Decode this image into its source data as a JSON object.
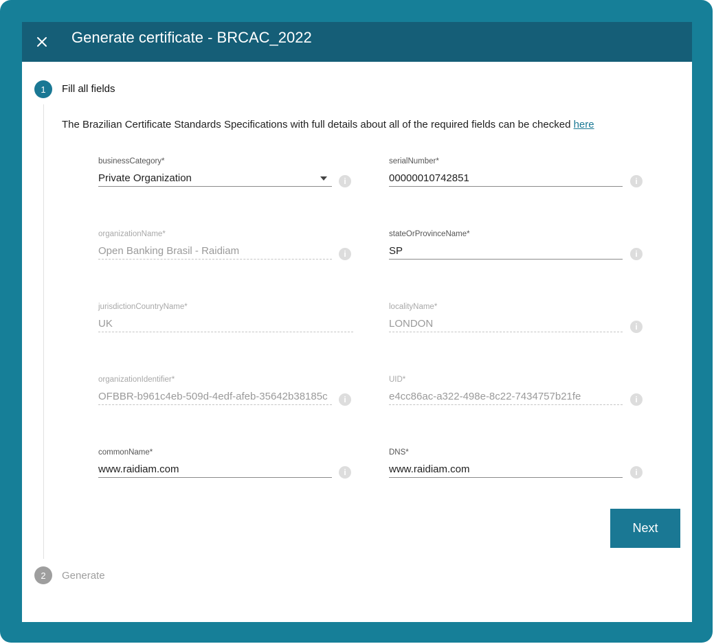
{
  "dialog": {
    "title": "Generate certificate - BRCAC_2022"
  },
  "stepper": {
    "step1": {
      "number": "1",
      "label": "Fill all fields"
    },
    "step2": {
      "number": "2",
      "label": "Generate"
    }
  },
  "description": {
    "text": "The Brazilian Certificate Standards Specifications with full details about all of the required fields can be checked ",
    "link": "here"
  },
  "fields": {
    "businessCategory": {
      "label": "businessCategory*",
      "value": "Private Organization"
    },
    "serialNumber": {
      "label": "serialNumber*",
      "value": "00000010742851"
    },
    "organizationName": {
      "label": "organizationName*",
      "value": "Open Banking Brasil - Raidiam"
    },
    "stateOrProvinceName": {
      "label": "stateOrProvinceName*",
      "value": "SP"
    },
    "jurisdictionCountryName": {
      "label": "jurisdictionCountryName*",
      "value": "UK"
    },
    "localityName": {
      "label": "localityName*",
      "value": "LONDON"
    },
    "organizationIdentifier": {
      "label": "organizationIdentifier*",
      "value": "OFBBR-b961c4eb-509d-4edf-afeb-35642b38185c"
    },
    "uid": {
      "label": "UID*",
      "value": "e4cc86ac-a322-498e-8c22-7434757b21fe"
    },
    "commonName": {
      "label": "commonName*",
      "value": "www.raidiam.com"
    },
    "dns": {
      "label": "DNS*",
      "value": "www.raidiam.com"
    }
  },
  "info_glyph": "i",
  "next_label": "Next",
  "colors": {
    "frame": "#167f98",
    "header": "#155e77",
    "accent": "#1a7894",
    "inactive": "#9e9e9e"
  }
}
